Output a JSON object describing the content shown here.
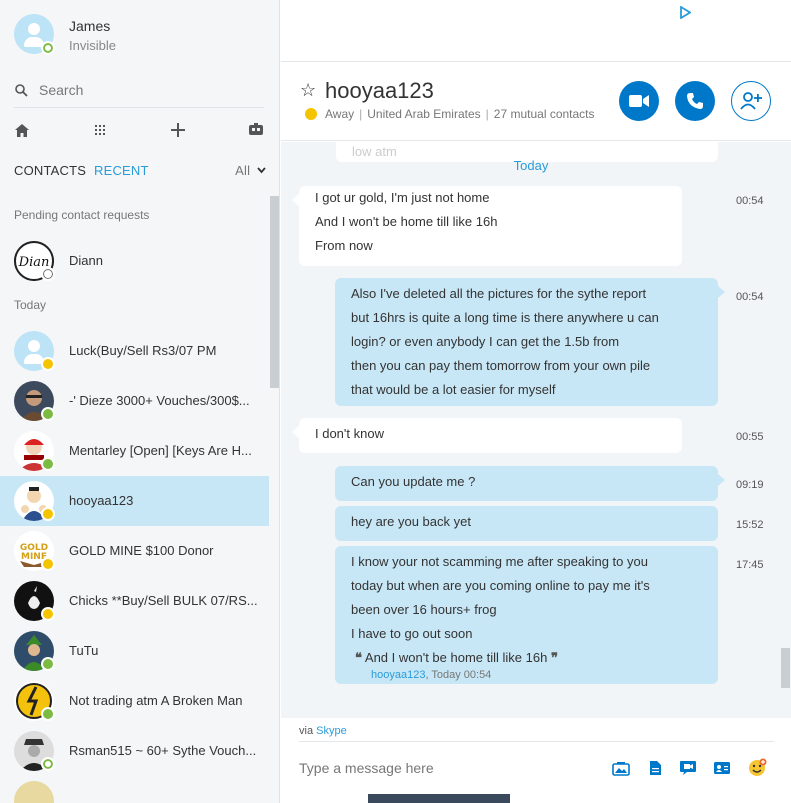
{
  "colors": {
    "accent": "#2a9cd8",
    "call_button": "#0078c9",
    "away": "#f5c400",
    "online": "#7cbb42",
    "bubble_out": "#c8e7f6"
  },
  "me": {
    "name": "James",
    "status": "Invisible"
  },
  "search": {
    "placeholder": "Search"
  },
  "toolbar": {
    "icons": [
      "home-icon",
      "dialpad-icon",
      "add-icon",
      "bot-icon"
    ]
  },
  "tabs": {
    "contacts": "CONTACTS",
    "recent": "RECENT",
    "filter": "All"
  },
  "sidebar": {
    "pending_label": "Pending contact requests",
    "today_label": "Today",
    "pending": [
      {
        "name": "Diann",
        "status": "invite"
      }
    ],
    "recent": [
      {
        "name": "Luck(Buy/Sell Rs3/07 PM",
        "status": "away"
      },
      {
        "name": "-' Dieze 3000+ Vouches/300$...",
        "status": "online"
      },
      {
        "name": "Mentarley [Open] [Keys Are H...",
        "status": "online"
      },
      {
        "name": "hooyaa123",
        "status": "away",
        "selected": true
      },
      {
        "name": "GOLD MINE $100 Donor",
        "status": "away"
      },
      {
        "name": "Chicks **Buy/Sell BULK 07/RS...",
        "status": "away"
      },
      {
        "name": "TuTu",
        "status": "online"
      },
      {
        "name": "Not trading atm A Broken Man",
        "status": "online"
      },
      {
        "name": "Rsman515 ~ 60+ Sythe Vouch...",
        "status": "invisible"
      }
    ]
  },
  "chat": {
    "title": "hooyaa123",
    "status": "Away",
    "location": "United Arab Emirates",
    "mutual": "27 mutual contacts",
    "prev_fragment": "low atm",
    "day_label": "Today",
    "messages": [
      {
        "dir": "in",
        "time": "00:54",
        "lines": [
          "I got ur gold, I'm just not home",
          "And I won't be home till like 16h",
          "From now"
        ]
      },
      {
        "dir": "out",
        "time": "00:54",
        "lines": [
          "Also I've deleted all the pictures for the sythe report",
          "but 16hrs is quite a long time is there anywhere u can",
          "login? or even anybody I can get the 1.5b from",
          "then you can pay them tomorrow from your own pile",
          "that would be a lot easier for myself"
        ]
      },
      {
        "dir": "in",
        "time": "00:55",
        "lines": [
          "I don't know"
        ]
      },
      {
        "dir": "out",
        "time": "09:19",
        "lines": [
          "Can you update me ?"
        ]
      },
      {
        "dir": "out",
        "time": "15:52",
        "lines": [
          "hey are you back yet"
        ]
      },
      {
        "dir": "out",
        "time": "17:45",
        "lines": [
          "I know your not scamming me after speaking to you",
          "today but when are you coming online to pay me it's",
          "been over 16 hours+ frog",
          "I have to go out soon"
        ],
        "quote": {
          "open": "❝",
          "close": "❞",
          "text": "And I won't be home till like 16h",
          "author": "hooyaa123",
          "meta": ", Today 00:54"
        }
      }
    ]
  },
  "compose": {
    "via": "via",
    "via_brand": "Skype",
    "placeholder": "Type a message here",
    "icons": [
      "media-icon",
      "file-icon",
      "video-message-icon",
      "contact-card-icon",
      "emoticon-icon"
    ]
  }
}
